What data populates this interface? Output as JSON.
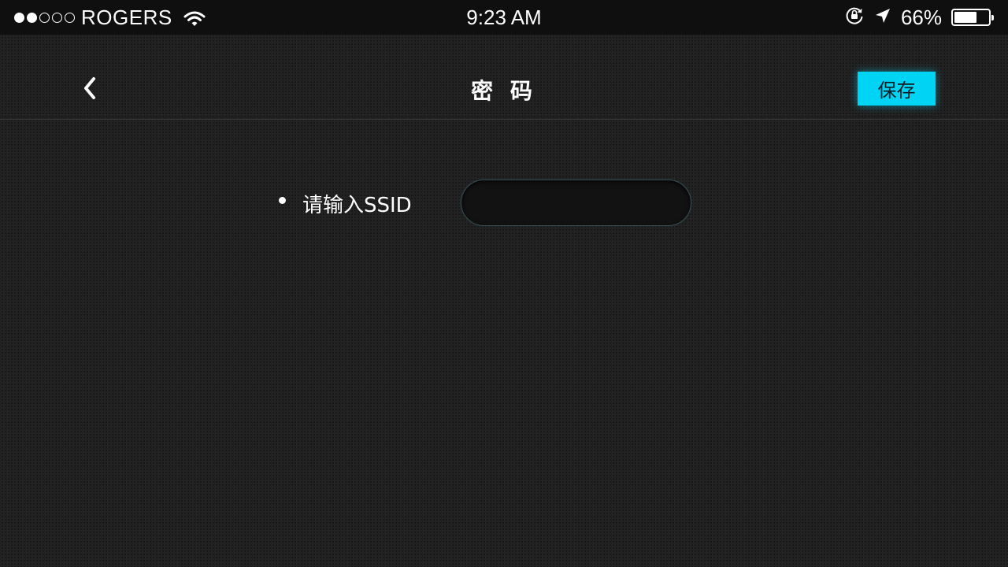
{
  "status_bar": {
    "signal_bars_on": 2,
    "signal_bars_total": 5,
    "carrier": "ROGERS",
    "wifi_icon": "wifi-icon",
    "time": "9:23 AM",
    "orientation_lock_icon": "orientation-lock-icon",
    "location_icon": "location-arrow-icon",
    "battery_percent": "66%",
    "battery_level": 0.66
  },
  "nav": {
    "back_icon": "chevron-left-icon",
    "title": "密 码",
    "save_label": "保存",
    "accent_color": "#00d4f5"
  },
  "form": {
    "ssid_label": "请输入SSID",
    "ssid_value": "",
    "ssid_placeholder": ""
  }
}
